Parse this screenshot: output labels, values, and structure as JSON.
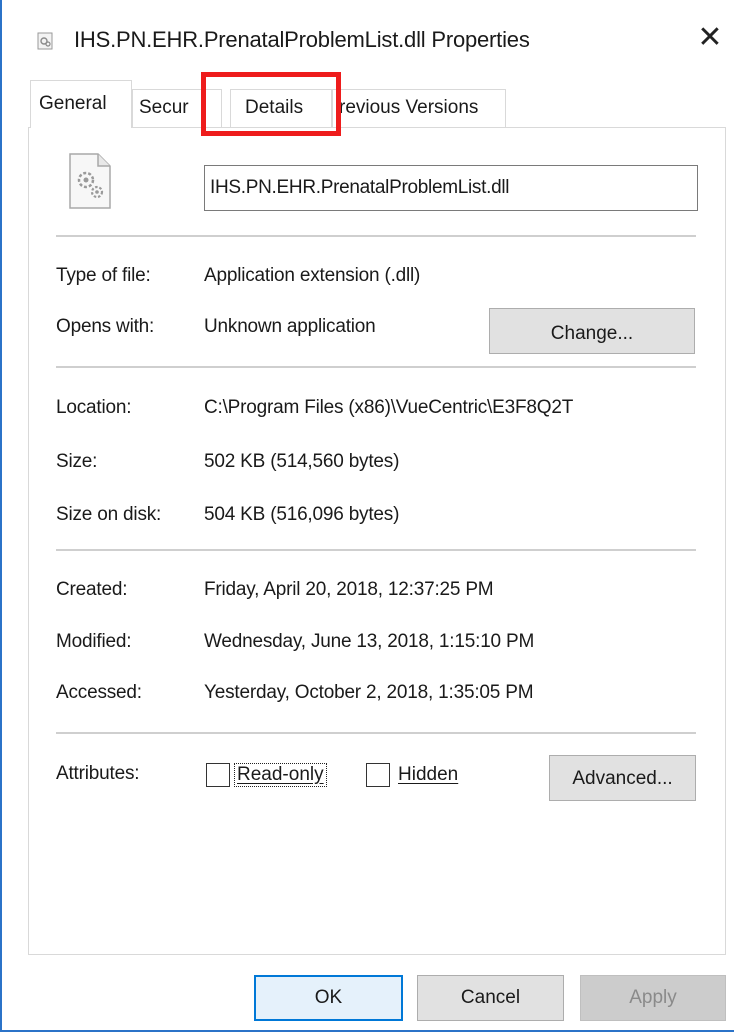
{
  "window": {
    "title": "IHS.PN.EHR.PrenatalProblemList.dll Properties",
    "close_symbol": "✕"
  },
  "tabs": [
    {
      "label": "General",
      "active": true
    },
    {
      "label": "Secur",
      "active": false
    },
    {
      "label": "Details",
      "active": false
    },
    {
      "label": "revious Versions",
      "active": false
    }
  ],
  "general": {
    "file_name": "IHS.PN.EHR.PrenatalProblemList.dll",
    "type_label": "Type of file:",
    "type_value": "Application extension (.dll)",
    "opens_label": "Opens with:",
    "opens_value": "Unknown application",
    "change_button": "Change...",
    "location_label": "Location:",
    "location_value": "C:\\Program Files (x86)\\VueCentric\\E3F8Q2T",
    "size_label": "Size:",
    "size_value": "502 KB (514,560 bytes)",
    "size_on_disk_label": "Size on disk:",
    "size_on_disk_value": "504 KB (516,096 bytes)",
    "created_label": "Created:",
    "created_value": "Friday, April 20, 2018, 12:37:25 PM",
    "modified_label": "Modified:",
    "modified_value": "Wednesday, June 13, 2018, 1:15:10 PM",
    "accessed_label": "Accessed:",
    "accessed_value": "Yesterday, October 2, 2018, 1:35:05 PM",
    "attributes_label": "Attributes:",
    "readonly_label": "Read-only",
    "readonly_checked": false,
    "hidden_label": "Hidden",
    "hidden_checked": false,
    "advanced_button": "Advanced..."
  },
  "footer": {
    "ok": "OK",
    "cancel": "Cancel",
    "apply": "Apply"
  },
  "colors": {
    "highlight": "#ee1c1c",
    "window_border": "#2b73c8",
    "default_button_border": "#0078d7"
  }
}
